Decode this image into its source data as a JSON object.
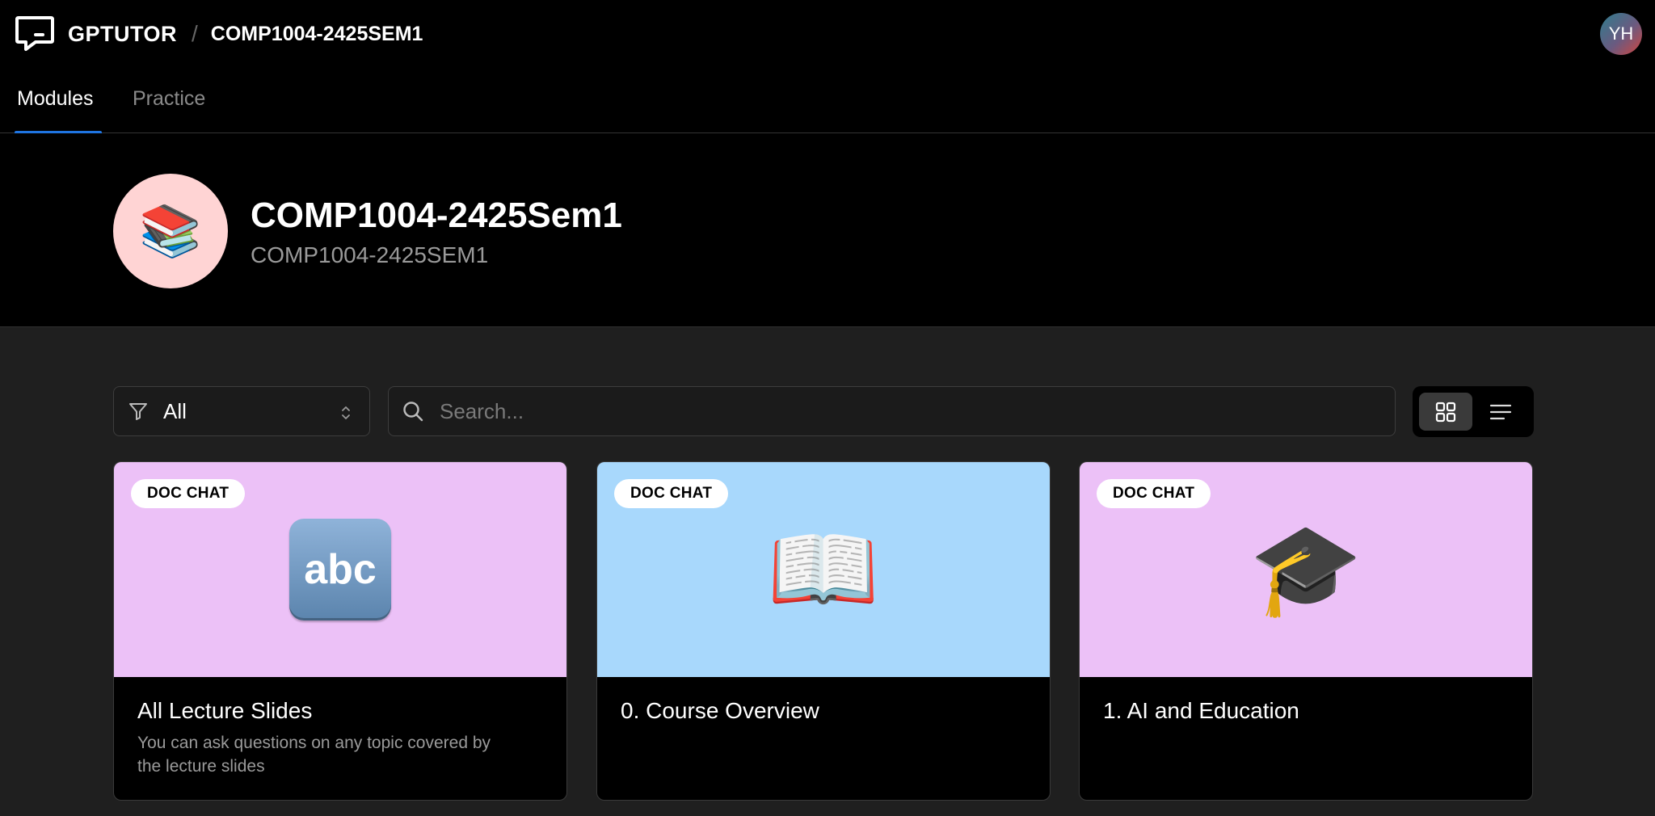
{
  "header": {
    "brand": "GPTUTOR",
    "separator": "/",
    "course_crumb": "COMP1004-2425SEM1",
    "avatar_initials": "YH"
  },
  "tabs": [
    {
      "label": "Modules",
      "active": true
    },
    {
      "label": "Practice",
      "active": false
    }
  ],
  "course": {
    "emoji": "📚",
    "title": "COMP1004-2425Sem1",
    "code": "COMP1004-2425SEM1"
  },
  "toolbar": {
    "filter_value": "All",
    "search_placeholder": "Search..."
  },
  "modules": [
    {
      "badge": "DOC CHAT",
      "icon": "abc-icon",
      "icon_text": "abc",
      "bg": "#ecc1f7",
      "title": "All Lecture Slides",
      "description": "You can ask questions on any topic covered by the lecture slides"
    },
    {
      "badge": "DOC CHAT",
      "icon": "open-book-icon",
      "emoji": "📖",
      "bg": "#a8d8fc",
      "title": "0. Course Overview",
      "description": ""
    },
    {
      "badge": "DOC CHAT",
      "icon": "graduation-cap-icon",
      "emoji": "🎓",
      "bg": "#ecc1f7",
      "title": "1. AI and Education",
      "description": ""
    }
  ],
  "colors": {
    "accent": "#1f74e0",
    "page_bg": "#1f1f1f",
    "header_bg": "#000000"
  }
}
